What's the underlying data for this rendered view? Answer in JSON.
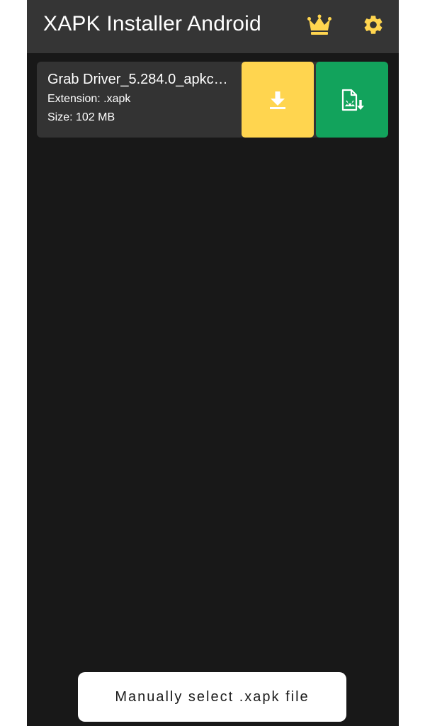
{
  "app": {
    "title": "XAPK Installer Android"
  },
  "header": {
    "icons": [
      "crown-icon",
      "gear-icon"
    ],
    "accent_color": "#ffd54f"
  },
  "file": {
    "name": "Grab Driver_5.284.0_apkco…",
    "extension": "Extension: .xapk",
    "size": "Size: 102 MB",
    "download_color": "#ffd54f",
    "install_color": "#12a35c"
  },
  "footer": {
    "manual_select_label": "Manually select .xapk file"
  },
  "colors": {
    "background": "#181818",
    "appbar": "#353535",
    "card": "#333333"
  }
}
